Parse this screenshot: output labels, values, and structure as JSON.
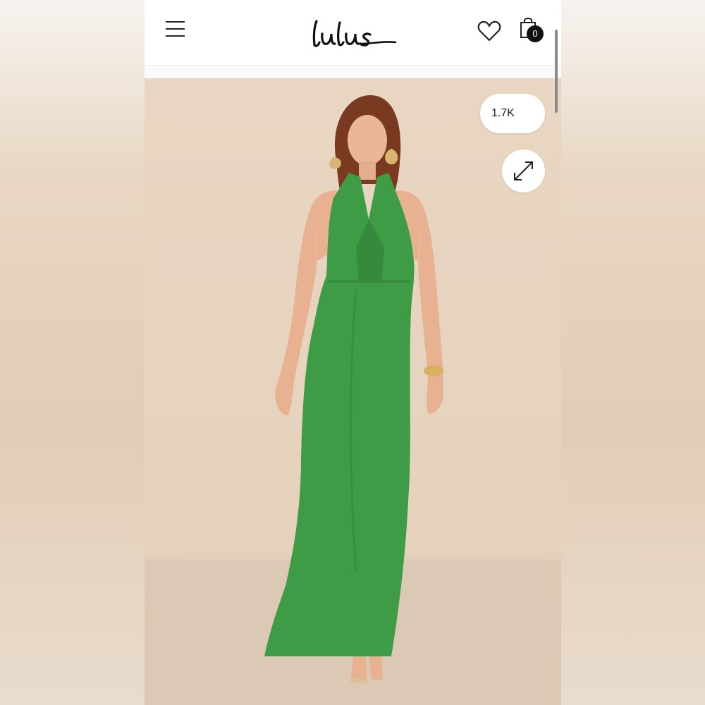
{
  "header": {
    "brand": "Lulus",
    "cart_count": "0"
  },
  "product_image": {
    "likes": "1.7K",
    "dress_color": "#3e9c47",
    "background_color": "#e7d4bf"
  },
  "icons": {
    "menu": "hamburger-menu-icon",
    "wishlist": "heart-icon",
    "cart": "shopping-bag-icon",
    "expand": "expand-arrows-icon"
  }
}
